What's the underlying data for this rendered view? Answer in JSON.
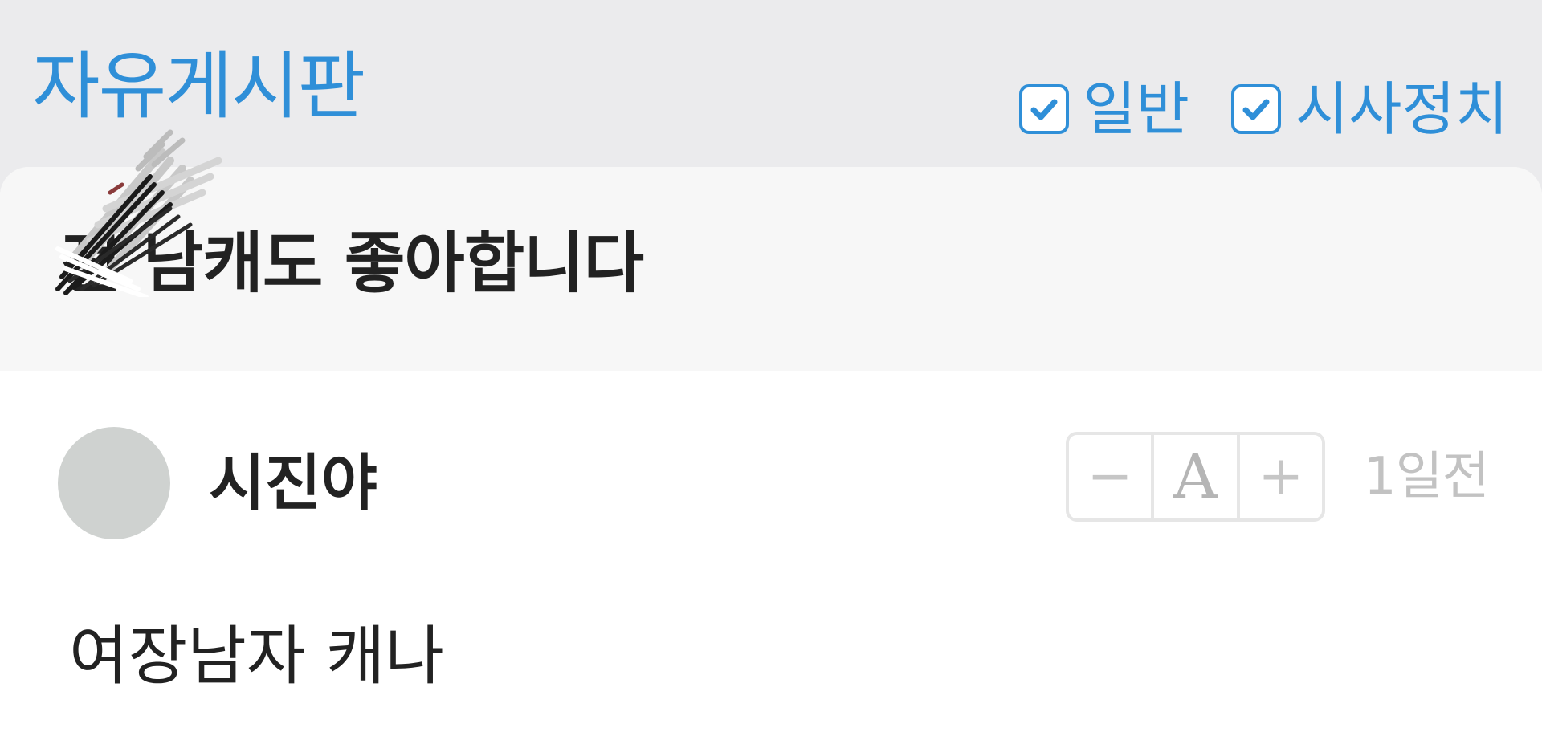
{
  "header": {
    "board_title": "자유게시판",
    "filters": [
      {
        "label": "일반",
        "checked": true
      },
      {
        "label": "시사정치",
        "checked": true
      }
    ]
  },
  "post": {
    "title": "전 남캐도 좋아합니다",
    "author": "시진야",
    "time": "1일전",
    "body": "여장남자 캐나"
  },
  "font_controls": {
    "decrease": "−",
    "font": "A",
    "increase": "+"
  },
  "colors": {
    "accent": "#2f8fd8",
    "header_bg": "#ebebed",
    "title_bar_bg": "#f7f7f7",
    "muted_text": "#c2c2c2"
  }
}
